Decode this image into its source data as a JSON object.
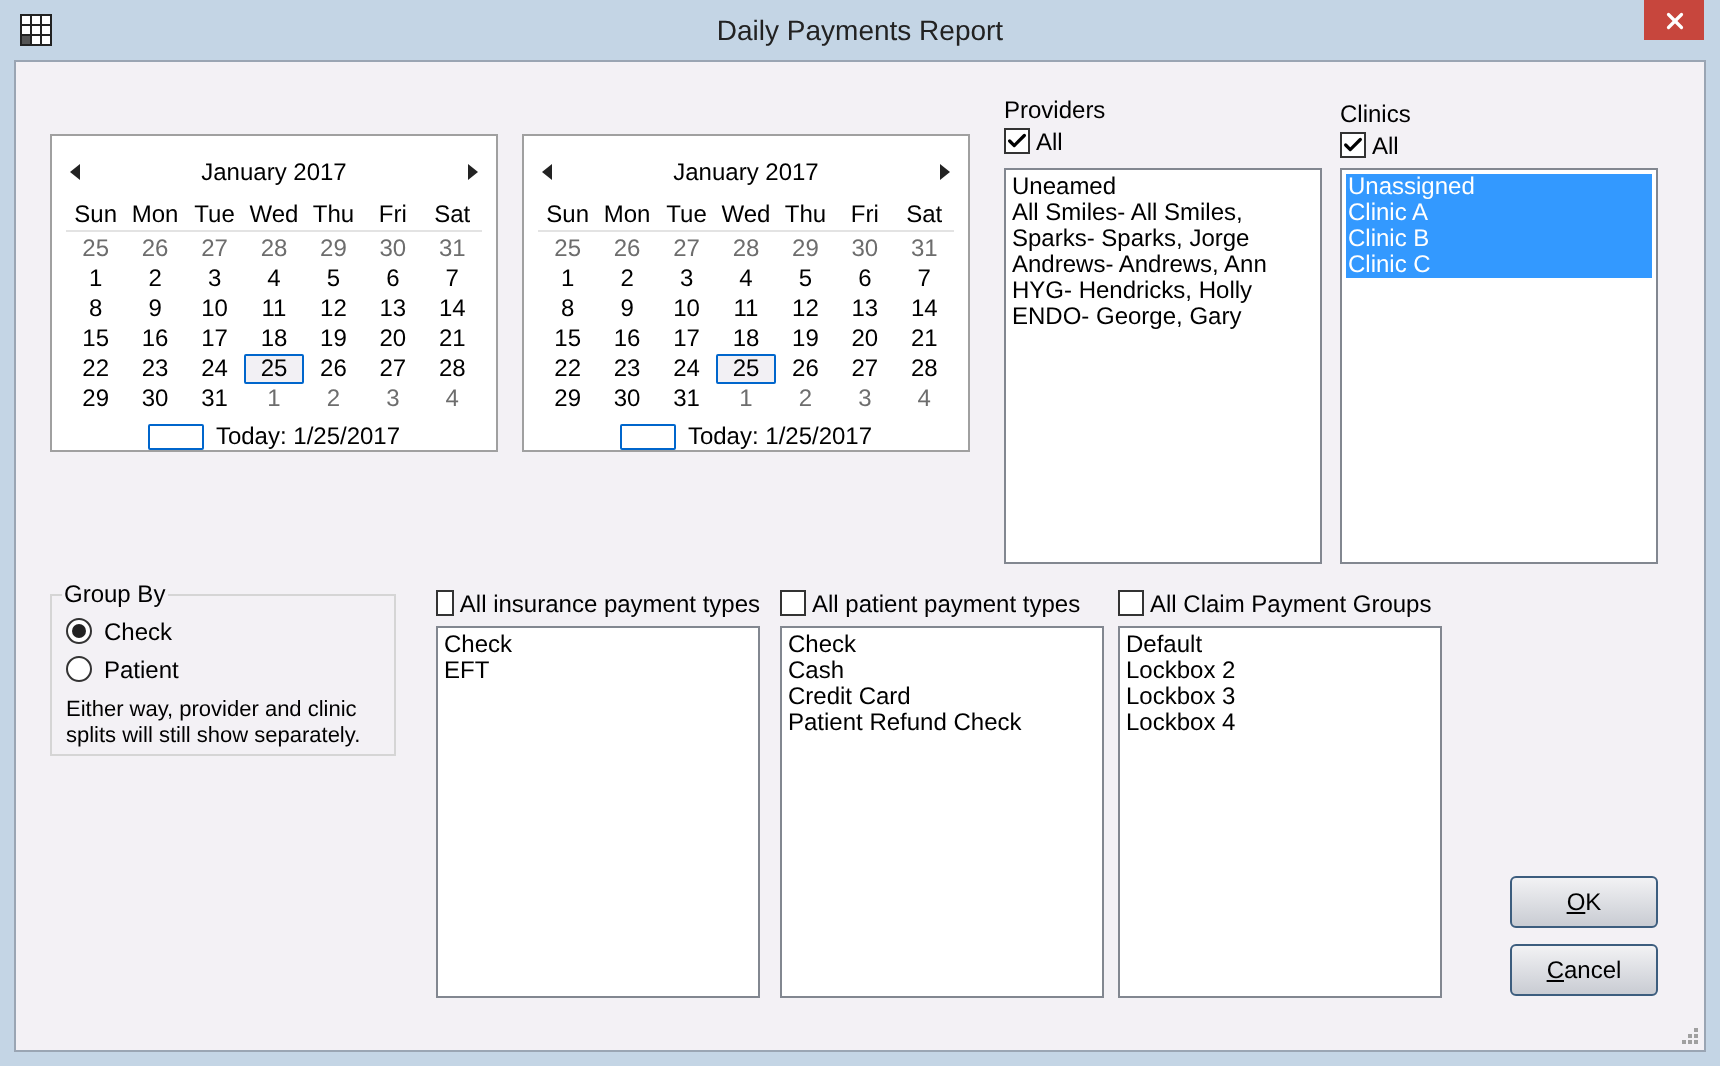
{
  "window": {
    "title": "Daily Payments Report"
  },
  "calendars": [
    {
      "month": "January 2017",
      "weekdays": [
        "Sun",
        "Mon",
        "Tue",
        "Wed",
        "Thu",
        "Fri",
        "Sat"
      ],
      "today": "Today: 1/25/2017",
      "days": [
        {
          "text": "25",
          "trailing": true,
          "selected": false
        },
        {
          "text": "26",
          "trailing": true,
          "selected": false
        },
        {
          "text": "27",
          "trailing": true,
          "selected": false
        },
        {
          "text": "28",
          "trailing": true,
          "selected": false
        },
        {
          "text": "29",
          "trailing": true,
          "selected": false
        },
        {
          "text": "30",
          "trailing": true,
          "selected": false
        },
        {
          "text": "31",
          "trailing": true,
          "selected": false
        },
        {
          "text": "1",
          "trailing": false,
          "selected": false
        },
        {
          "text": "2",
          "trailing": false,
          "selected": false
        },
        {
          "text": "3",
          "trailing": false,
          "selected": false
        },
        {
          "text": "4",
          "trailing": false,
          "selected": false
        },
        {
          "text": "5",
          "trailing": false,
          "selected": false
        },
        {
          "text": "6",
          "trailing": false,
          "selected": false
        },
        {
          "text": "7",
          "trailing": false,
          "selected": false
        },
        {
          "text": "8",
          "trailing": false,
          "selected": false
        },
        {
          "text": "9",
          "trailing": false,
          "selected": false
        },
        {
          "text": "10",
          "trailing": false,
          "selected": false
        },
        {
          "text": "11",
          "trailing": false,
          "selected": false
        },
        {
          "text": "12",
          "trailing": false,
          "selected": false
        },
        {
          "text": "13",
          "trailing": false,
          "selected": false
        },
        {
          "text": "14",
          "trailing": false,
          "selected": false
        },
        {
          "text": "15",
          "trailing": false,
          "selected": false
        },
        {
          "text": "16",
          "trailing": false,
          "selected": false
        },
        {
          "text": "17",
          "trailing": false,
          "selected": false
        },
        {
          "text": "18",
          "trailing": false,
          "selected": false
        },
        {
          "text": "19",
          "trailing": false,
          "selected": false
        },
        {
          "text": "20",
          "trailing": false,
          "selected": false
        },
        {
          "text": "21",
          "trailing": false,
          "selected": false
        },
        {
          "text": "22",
          "trailing": false,
          "selected": false
        },
        {
          "text": "23",
          "trailing": false,
          "selected": false
        },
        {
          "text": "24",
          "trailing": false,
          "selected": false
        },
        {
          "text": "25",
          "trailing": false,
          "selected": true
        },
        {
          "text": "26",
          "trailing": false,
          "selected": false
        },
        {
          "text": "27",
          "trailing": false,
          "selected": false
        },
        {
          "text": "28",
          "trailing": false,
          "selected": false
        },
        {
          "text": "29",
          "trailing": false,
          "selected": false
        },
        {
          "text": "30",
          "trailing": false,
          "selected": false
        },
        {
          "text": "31",
          "trailing": false,
          "selected": false
        },
        {
          "text": "1",
          "trailing": true,
          "selected": false
        },
        {
          "text": "2",
          "trailing": true,
          "selected": false
        },
        {
          "text": "3",
          "trailing": true,
          "selected": false
        },
        {
          "text": "4",
          "trailing": true,
          "selected": false
        }
      ]
    },
    {
      "month": "January 2017",
      "weekdays": [
        "Sun",
        "Mon",
        "Tue",
        "Wed",
        "Thu",
        "Fri",
        "Sat"
      ],
      "today": "Today: 1/25/2017",
      "days": [
        {
          "text": "25",
          "trailing": true,
          "selected": false
        },
        {
          "text": "26",
          "trailing": true,
          "selected": false
        },
        {
          "text": "27",
          "trailing": true,
          "selected": false
        },
        {
          "text": "28",
          "trailing": true,
          "selected": false
        },
        {
          "text": "29",
          "trailing": true,
          "selected": false
        },
        {
          "text": "30",
          "trailing": true,
          "selected": false
        },
        {
          "text": "31",
          "trailing": true,
          "selected": false
        },
        {
          "text": "1",
          "trailing": false,
          "selected": false
        },
        {
          "text": "2",
          "trailing": false,
          "selected": false
        },
        {
          "text": "3",
          "trailing": false,
          "selected": false
        },
        {
          "text": "4",
          "trailing": false,
          "selected": false
        },
        {
          "text": "5",
          "trailing": false,
          "selected": false
        },
        {
          "text": "6",
          "trailing": false,
          "selected": false
        },
        {
          "text": "7",
          "trailing": false,
          "selected": false
        },
        {
          "text": "8",
          "trailing": false,
          "selected": false
        },
        {
          "text": "9",
          "trailing": false,
          "selected": false
        },
        {
          "text": "10",
          "trailing": false,
          "selected": false
        },
        {
          "text": "11",
          "trailing": false,
          "selected": false
        },
        {
          "text": "12",
          "trailing": false,
          "selected": false
        },
        {
          "text": "13",
          "trailing": false,
          "selected": false
        },
        {
          "text": "14",
          "trailing": false,
          "selected": false
        },
        {
          "text": "15",
          "trailing": false,
          "selected": false
        },
        {
          "text": "16",
          "trailing": false,
          "selected": false
        },
        {
          "text": "17",
          "trailing": false,
          "selected": false
        },
        {
          "text": "18",
          "trailing": false,
          "selected": false
        },
        {
          "text": "19",
          "trailing": false,
          "selected": false
        },
        {
          "text": "20",
          "trailing": false,
          "selected": false
        },
        {
          "text": "21",
          "trailing": false,
          "selected": false
        },
        {
          "text": "22",
          "trailing": false,
          "selected": false
        },
        {
          "text": "23",
          "trailing": false,
          "selected": false
        },
        {
          "text": "24",
          "trailing": false,
          "selected": false
        },
        {
          "text": "25",
          "trailing": false,
          "selected": true
        },
        {
          "text": "26",
          "trailing": false,
          "selected": false
        },
        {
          "text": "27",
          "trailing": false,
          "selected": false
        },
        {
          "text": "28",
          "trailing": false,
          "selected": false
        },
        {
          "text": "29",
          "trailing": false,
          "selected": false
        },
        {
          "text": "30",
          "trailing": false,
          "selected": false
        },
        {
          "text": "31",
          "trailing": false,
          "selected": false
        },
        {
          "text": "1",
          "trailing": true,
          "selected": false
        },
        {
          "text": "2",
          "trailing": true,
          "selected": false
        },
        {
          "text": "3",
          "trailing": true,
          "selected": false
        },
        {
          "text": "4",
          "trailing": true,
          "selected": false
        }
      ]
    }
  ],
  "providers": {
    "label": "Providers",
    "all": {
      "label": "All",
      "checked": true
    },
    "items": [
      {
        "text": "Uneamed",
        "selected": false
      },
      {
        "text": "All Smiles- All Smiles,",
        "selected": false
      },
      {
        "text": "Sparks- Sparks, Jorge",
        "selected": false
      },
      {
        "text": "Andrews- Andrews, Ann",
        "selected": false
      },
      {
        "text": "HYG- Hendricks, Holly",
        "selected": false
      },
      {
        "text": "ENDO- George, Gary",
        "selected": false
      }
    ]
  },
  "clinics": {
    "label": "Clinics",
    "all": {
      "label": "All",
      "checked": true
    },
    "items": [
      {
        "text": "Unassigned",
        "selected": true
      },
      {
        "text": "Clinic A",
        "selected": true
      },
      {
        "text": "Clinic B",
        "selected": true
      },
      {
        "text": "Clinic C",
        "selected": true
      }
    ]
  },
  "group_by": {
    "title": "Group By",
    "options": [
      {
        "label": "Check",
        "selected": true
      },
      {
        "label": "Patient",
        "selected": false
      }
    ],
    "note": "Either way, provider and clinic splits will still show separately."
  },
  "payment_lists": [
    {
      "all": {
        "label": "All insurance payment types",
        "checked": false
      },
      "items": [
        {
          "text": "Check",
          "selected": false
        },
        {
          "text": "EFT",
          "selected": false
        }
      ]
    },
    {
      "all": {
        "label": "All patient payment types",
        "checked": false
      },
      "items": [
        {
          "text": "Check",
          "selected": false
        },
        {
          "text": "Cash",
          "selected": false
        },
        {
          "text": "Credit Card",
          "selected": false
        },
        {
          "text": "Patient Refund Check",
          "selected": false
        }
      ]
    },
    {
      "all": {
        "label": "All Claim Payment Groups",
        "checked": false
      },
      "items": [
        {
          "text": "Default",
          "selected": false
        },
        {
          "text": "Lockbox 2",
          "selected": false
        },
        {
          "text": "Lockbox 3",
          "selected": false
        },
        {
          "text": "Lockbox 4",
          "selected": false
        }
      ]
    }
  ],
  "buttons": [
    {
      "access": "O",
      "rest": "K"
    },
    {
      "access": "C",
      "rest": "ancel"
    }
  ]
}
